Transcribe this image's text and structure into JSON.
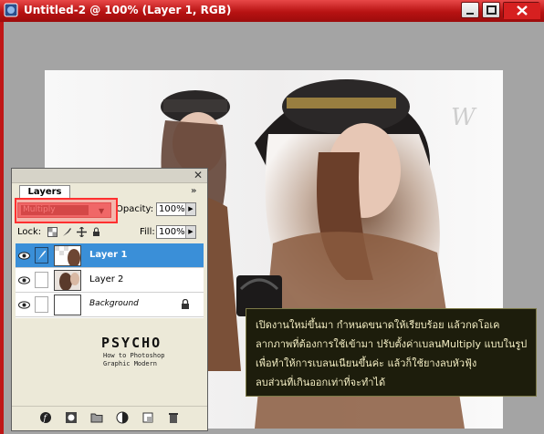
{
  "window": {
    "title": "Untitled-2 @ 100% (Layer 1, RGB)"
  },
  "layers_panel": {
    "tab_label": "Layers",
    "blend_mode": "Multiply",
    "opacity_label": "Opacity:",
    "opacity_value": "100%",
    "lock_label": "Lock:",
    "fill_label": "Fill:",
    "fill_value": "100%",
    "layers": [
      {
        "name": "Layer 1",
        "selected": true,
        "visible": true
      },
      {
        "name": "Layer 2",
        "selected": false,
        "visible": true
      },
      {
        "name": "Background",
        "selected": false,
        "visible": true,
        "locked": true
      }
    ],
    "logo_title": "PSYCHO",
    "logo_sub1": "How to Photoshop",
    "logo_sub2": "Graphic Modern"
  },
  "annotation": {
    "lines": [
      "เปิดงานใหม่ขึ้นมา กำหนดขนาดให้เรียบร้อย แล้วกดโอเค",
      "ลากภาพที่ต้องการใช้เข้ามา ปรับตั้งค่าเบลนMultiply แบบในรูป",
      "เพื่อทำให้การเบลนเนียนขึ้นค่ะ แล้วก็ใช้ยางลบหัวฟุ้ง",
      "ลบส่วนที่เกินออกเท่าที่จะทำได้"
    ]
  },
  "colors": {
    "titlebar": "#b71212",
    "selected_layer": "#3a8fd8",
    "highlight_box": "#ff3030",
    "note_bg": "#1d1d0c",
    "note_text": "#f4eec4"
  }
}
